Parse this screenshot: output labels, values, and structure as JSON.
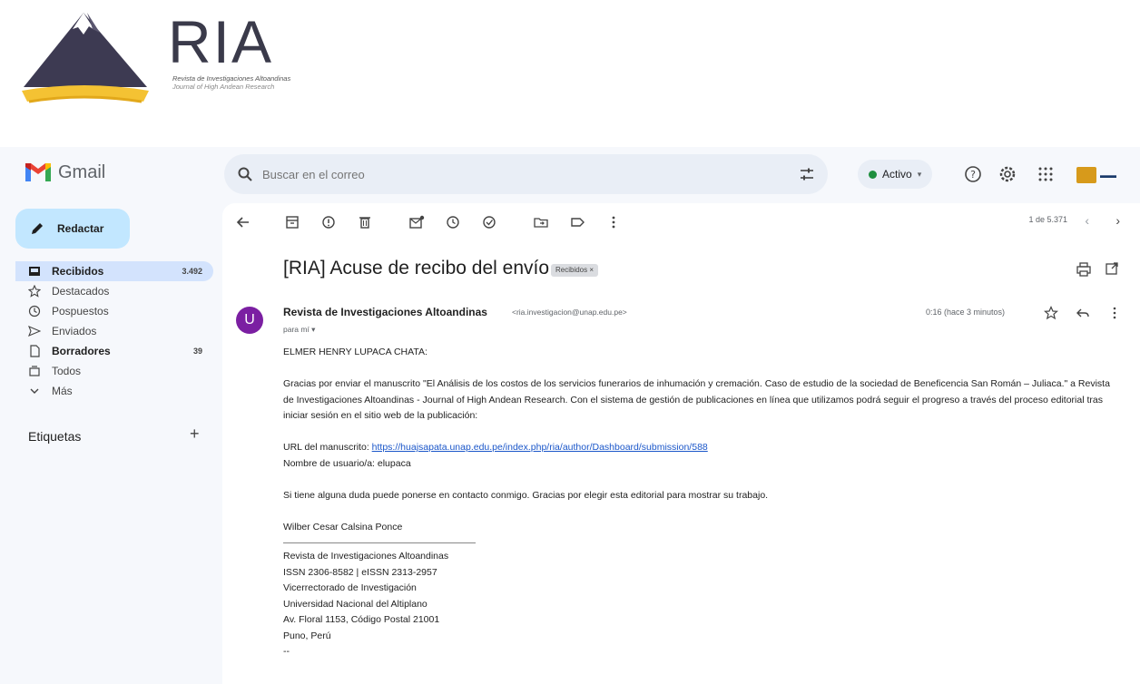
{
  "journal": {
    "acronym": "RIA",
    "name_es": "Revista de Investigaciones Altoandinas",
    "name_en": "Journal of High Andean Research"
  },
  "gmail": {
    "app_name": "Gmail",
    "search_placeholder": "Buscar en el correo",
    "status_label": "Activo",
    "compose_label": "Redactar",
    "nav": [
      {
        "label": "Recibidos",
        "count": "3.492",
        "icon": "inbox-icon"
      },
      {
        "label": "Destacados",
        "count": "",
        "icon": "star-icon"
      },
      {
        "label": "Pospuestos",
        "count": "",
        "icon": "clock-icon"
      },
      {
        "label": "Enviados",
        "count": "",
        "icon": "send-icon"
      },
      {
        "label": "Borradores",
        "count": "39",
        "icon": "draft-icon"
      },
      {
        "label": "Todos",
        "count": "",
        "icon": "all-mail-icon"
      },
      {
        "label": "Más",
        "count": "",
        "icon": "chevron-down-icon"
      }
    ],
    "labels_heading": "Etiquetas",
    "labels_add": "+",
    "pager": "1 de 5.371"
  },
  "email": {
    "subject": "[RIA] Acuse de recibo del envío",
    "label_chip": "Recibidos ×",
    "sender_name": "Revista de Investigaciones Altoandinas",
    "sender_email": "<ria.investigacion@unap.edu.pe>",
    "to": "para mí ▾",
    "time": "0:16 (hace 3 minutos)",
    "avatar_letter": "U",
    "greeting": "ELMER HENRY LUPACA CHATA:",
    "paragraph1": "Gracias por enviar el manuscrito \"El Análisis de los costos de los servicios funerarios de inhumación y cremación. Caso de estudio de la sociedad de Beneficencia San Román – Juliaca.\" a Revista de Investigaciones Altoandinas - Journal of High Andean Research. Con el sistema de gestión de publicaciones en línea que utilizamos podrá seguir el progreso a través del proceso editorial tras iniciar sesión en el sitio web de la publicación:",
    "url_label": "URL del manuscrito:",
    "url": "https://huajsapata.unap.edu.pe/index.php/ria/author/Dashboard/submission/588",
    "username_line": "Nombre de usuario/a: elupaca",
    "paragraph2": "Si tiene alguna duda puede ponerse en contacto conmigo. Gracias por elegir esta editorial para mostrar su trabajo.",
    "signer": "Wilber Cesar Calsina Ponce",
    "signature": [
      "Revista de Investigaciones Altoandinas",
      "ISSN 2306-8582 | eISSN 2313-2957",
      "Vicerrectorado de Investigación",
      "Universidad Nacional del Altiplano",
      "Av. Floral 1153, Código Postal 21001",
      "Puno, Perú",
      "--"
    ]
  }
}
